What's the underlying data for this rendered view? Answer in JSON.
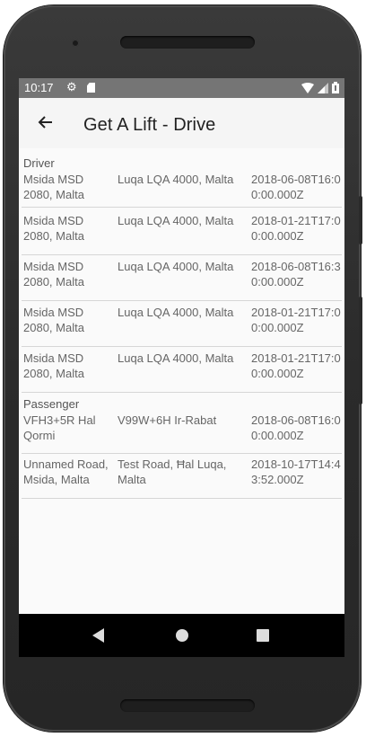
{
  "status_bar": {
    "time": "10:17",
    "icons": [
      "settings-gear-icon",
      "sd-card-icon",
      "wifi-icon",
      "signal-icon",
      "battery-icon"
    ]
  },
  "app_bar": {
    "title": "Get A Lift - Drive",
    "back_icon": "back-arrow-icon"
  },
  "sections": [
    {
      "label": "Driver",
      "rows": [
        {
          "from": "Msida MSD 2080, Malta",
          "to": "Luqa LQA 4000, Malta",
          "date": "2018-06-08T16:00:00.000Z"
        },
        {
          "from": "Msida MSD 2080, Malta",
          "to": "Luqa LQA 4000, Malta",
          "date": "2018-01-21T17:00:00.000Z"
        },
        {
          "from": "Msida MSD 2080, Malta",
          "to": "Luqa LQA 4000, Malta",
          "date": "2018-06-08T16:30:00.000Z"
        },
        {
          "from": "Msida MSD 2080, Malta",
          "to": "Luqa LQA 4000, Malta",
          "date": "2018-01-21T17:00:00.000Z"
        },
        {
          "from": "Msida MSD 2080, Malta",
          "to": "Luqa LQA 4000, Malta",
          "date": "2018-01-21T17:00:00.000Z"
        }
      ]
    },
    {
      "label": "Passenger",
      "rows": [
        {
          "from": "VFH3+5R Hal Qormi",
          "to": "V99W+6H Ir-Rabat",
          "date": "2018-06-08T16:00:00.000Z"
        },
        {
          "from": "Unnamed Road, Msida, Malta",
          "to": "Test Road, Ħal Luqa, Malta",
          "date": "2018-10-17T14:43:52.000Z"
        }
      ]
    }
  ],
  "nav_bar": {
    "icons": [
      "nav-back-icon",
      "nav-home-icon",
      "nav-recents-icon"
    ]
  }
}
